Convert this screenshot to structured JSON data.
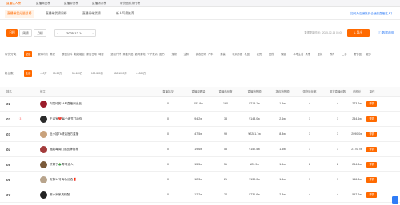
{
  "top_tabs": [
    "直播达人榜",
    "直播商品榜",
    "直播带货榜",
    "直播场次榜",
    "带货团队排行榜"
  ],
  "sub_tabs": [
    "直播带货分量总榜",
    "直播带货榜周榜",
    "直播间带货榜",
    "新人气榜推荐"
  ],
  "promo_link": "如何为店铺找到合适的直播达人？",
  "controls": {
    "periods": [
      "日榜",
      "周榜",
      "月榜"
    ],
    "date": "2025-12-14",
    "updated": "数据更新时间：2025-12-15 05:00",
    "export": "导出",
    "desc": "数据说明"
  },
  "category_filter": {
    "label": "带货分类",
    "options": [
      "全部",
      "服饰内衣",
      "美妆",
      "食品饮料",
      "鞋靴箱包",
      "家居日用",
      "母婴",
      "运动户外",
      "珠宝饰品",
      "数码家电",
      "个护家清",
      "图书",
      "宠物",
      "生鲜",
      "钟表配饰",
      "汽车",
      "家装",
      "玩具乐器",
      "礼品",
      "农资",
      "医药",
      "保健",
      "本地生活",
      "其他",
      "虚拟",
      "教育",
      "二手",
      "奢侈品",
      "更多"
    ]
  },
  "fans_filter": {
    "label": "粉丝数",
    "options": [
      "全部",
      "<10万",
      "10-50万",
      "50-100万",
      "100-500万",
      "500-1000万",
      ">1000万"
    ]
  },
  "table": {
    "headers": [
      "排名",
      "博主",
      "直播场次",
      "直播观看量",
      "直播商品数",
      "直播销售额",
      "场均销售额",
      "带货转化率",
      "带货直播间数",
      "总粉丝",
      "操作"
    ],
    "detail_label": "详情",
    "rows": [
      {
        "rank": "01",
        "change": "",
        "name": "刘嘉玲的14号直播间出品",
        "avatar": "#9b1c2a",
        "sessions": "0",
        "views": "152.9w",
        "items": "160",
        "gmv": "¥219.1w",
        "avg": "1.5w",
        "conv": "4",
        "rooms": "4",
        "fans": "273.2w"
      },
      {
        "rank": "02",
        "change": "↑ 3",
        "name": "王者宝❤️每个细节打动你",
        "avatar": "#2a2a2a",
        "sessions": "0",
        "views": "94.2w",
        "items": "33",
        "gmv": "¥143.0w",
        "avg": "2.6w",
        "conv": "1",
        "rooms": "1",
        "fans": "244.6w"
      },
      {
        "rank": "03",
        "change": "",
        "name": "肚小娃Tk精选官方直播",
        "avatar": "#c9a27c",
        "sessions": "0",
        "views": "47.5w",
        "items": "99",
        "gmv": "¥2281.7w",
        "avg": "8.8w",
        "conv": "3",
        "rooms": "3",
        "fans": "2090.0w"
      },
      {
        "rank": "04",
        "change": "",
        "name": "福娃每周门禁品牌推荐",
        "avatar": "#a33b3b",
        "sessions": "0",
        "views": "19.6w",
        "items": "55",
        "gmv": "¥152.5w",
        "avg": "1.5w",
        "conv": "1",
        "rooms": "1",
        "fans": "2170.7w"
      },
      {
        "rank": "05",
        "change": "",
        "name": "拼解于🎄寿寿这人",
        "avatar": "#7a5a3a",
        "sessions": "0",
        "views": "15.5w",
        "items": "51",
        "gmv": "¥20.9w",
        "avg": "1.5w",
        "conv": "2",
        "rooms": "2",
        "fans": "264.3w"
      },
      {
        "rank": "06",
        "change": "",
        "name": "安静14号海私优选🧧",
        "avatar": "#b8a48c",
        "sessions": "0",
        "views": "12.3w",
        "items": "21",
        "gmv": "¥130.0w",
        "avg": "1.6w",
        "conv": "1",
        "rooms": "1",
        "fans": "146.3w"
      },
      {
        "rank": "07",
        "change": "",
        "name": "佛小米家具精配",
        "avatar": "#222222",
        "sessions": "0",
        "views": "12.2w",
        "items": "24",
        "gmv": "¥731.6w",
        "avg": "2.3w",
        "conv": "4",
        "rooms": "4",
        "fans": "597.2w"
      }
    ]
  },
  "colors": {
    "accent": "#ff6a00",
    "link": "#2f7cf6"
  }
}
